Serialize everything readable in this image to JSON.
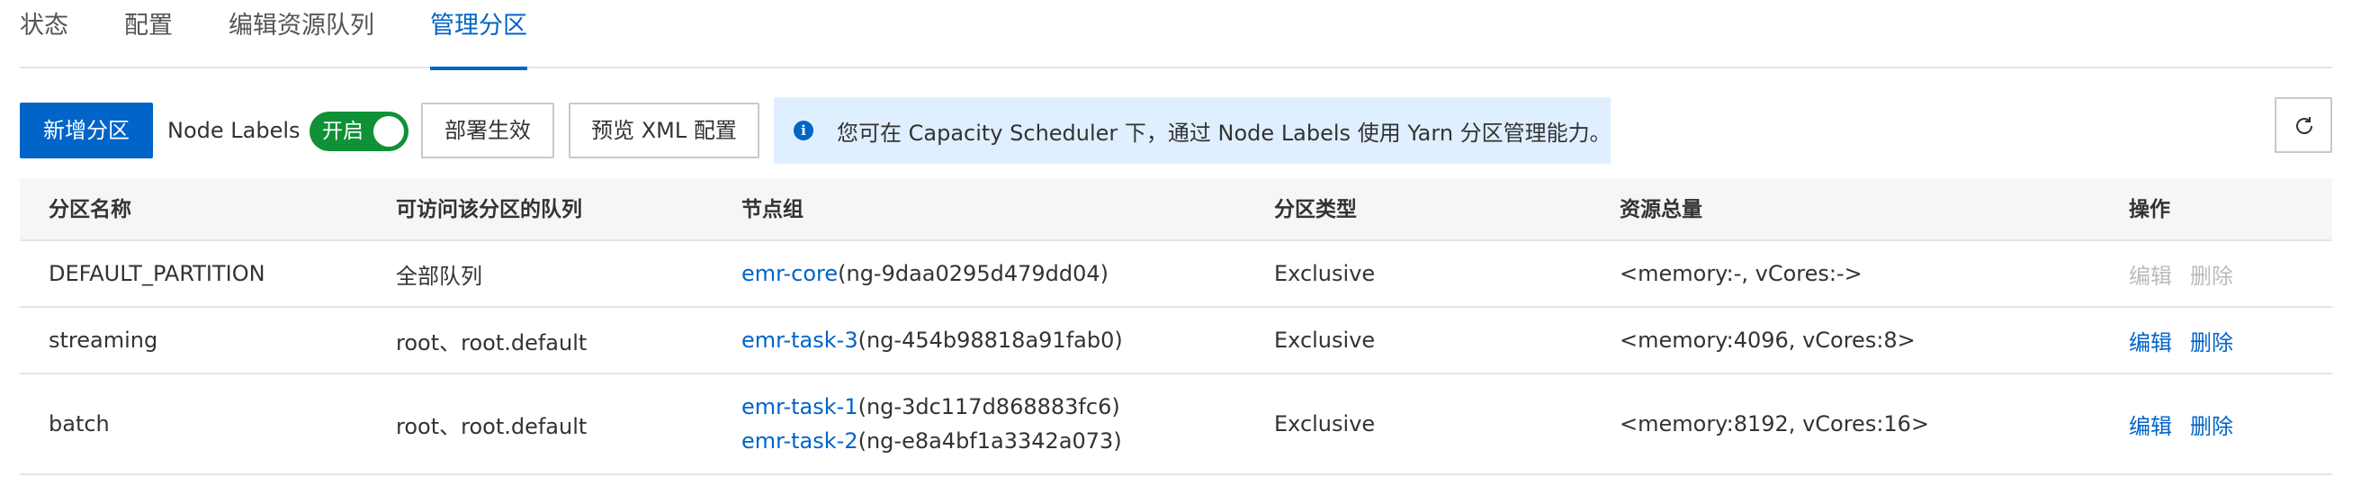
{
  "tabs": [
    {
      "label": "状态",
      "active": false
    },
    {
      "label": "配置",
      "active": false
    },
    {
      "label": "编辑资源队列",
      "active": false
    },
    {
      "label": "管理分区",
      "active": true
    }
  ],
  "toolbar": {
    "add_partition_label": "新增分区",
    "node_labels_label": "Node Labels",
    "switch_text": "开启",
    "switch_on": true,
    "deploy_label": "部署生效",
    "preview_xml_label": "预览 XML 配置",
    "notice_text": "您可在 Capacity Scheduler 下，通过 Node Labels 使用 Yarn 分区管理能力。",
    "refresh_icon": "refresh-icon"
  },
  "colors": {
    "primary": "#0064c8",
    "switch_on": "#0f9136",
    "notice_bg": "#e0efff",
    "disabled_text": "#bbbbbb"
  },
  "table": {
    "headers": [
      "分区名称",
      "可访问该分区的队列",
      "节点组",
      "分区类型",
      "资源总量",
      "操作"
    ],
    "rows": [
      {
        "name": "DEFAULT_PARTITION",
        "queues": "全部队列",
        "node_groups": [
          {
            "name": "emr-core",
            "id": "(ng-9daa0295d479dd04)"
          }
        ],
        "type": "Exclusive",
        "resources": "<memory:-, vCores:->",
        "edit_label": "编辑",
        "delete_label": "删除",
        "ops_enabled": false
      },
      {
        "name": "streaming",
        "queues": "root、root.default",
        "node_groups": [
          {
            "name": "emr-task-3",
            "id": "(ng-454b98818a91fab0)"
          }
        ],
        "type": "Exclusive",
        "resources": "<memory:4096, vCores:8>",
        "edit_label": "编辑",
        "delete_label": "删除",
        "ops_enabled": true
      },
      {
        "name": "batch",
        "queues": "root、root.default",
        "node_groups": [
          {
            "name": "emr-task-1",
            "id": "(ng-3dc117d868883fc6)"
          },
          {
            "name": "emr-task-2",
            "id": "(ng-e8a4bf1a3342a073)"
          }
        ],
        "type": "Exclusive",
        "resources": "<memory:8192, vCores:16>",
        "edit_label": "编辑",
        "delete_label": "删除",
        "ops_enabled": true
      }
    ]
  }
}
